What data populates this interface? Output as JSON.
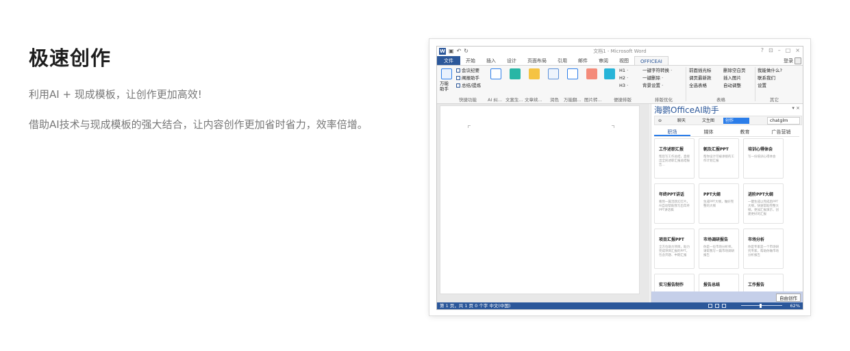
{
  "hero": {
    "title": "极速创作",
    "subtitle1": "利用AI + 现成模板，让创作更加高效!",
    "subtitle2": "借助AI技术与现成模板的强大结合，让内容创作更加省时省力，效率倍增。"
  },
  "word": {
    "doc_title": "文档1 - Microsoft Word",
    "window_controls": [
      "?",
      "⊡",
      "–",
      "□",
      "×"
    ],
    "tabs": [
      "文件",
      "开始",
      "插入",
      "设计",
      "页面布局",
      "引用",
      "邮件",
      "审阅",
      "视图",
      "OFFICEAI"
    ],
    "login": "登录",
    "ribbon": {
      "wanneng": "万能\n助手",
      "meeting": [
        "会议纪要",
        "阐报助手",
        "总结/提炼"
      ],
      "group_labels": [
        "快捷功能",
        "AI 纠...",
        "文案生...",
        "文章续...",
        "润色",
        "万能翻...",
        "图片转...",
        "便捷排版",
        "排版优化",
        "表格",
        "其它"
      ],
      "headings": [
        "H1 ·",
        "H2 ·",
        "H3 ·"
      ],
      "convert": [
        "一键字符转换 ·",
        "一键删除 ·",
        "背景设置 ·"
      ],
      "table_tools": [
        "前面插光标",
        "调页最新款",
        "全选表格"
      ],
      "table_tools2": [
        "删除空白页",
        "插入图片",
        "自动调整"
      ],
      "other": [
        "我能做什么?",
        "联系我们",
        "设置"
      ]
    },
    "status": {
      "left": "第 1 页，共 1 页   0 个字   中文(中国)",
      "zoom": "62%"
    }
  },
  "panel": {
    "title": "海鹦OfficeAI助手",
    "toolbar": [
      "聊天",
      "文生图",
      "创作"
    ],
    "model": "chatglm",
    "tabs": [
      "职场",
      "媒体",
      "教育",
      "广告营销"
    ],
    "cards": [
      {
        "title": "工作述职汇报",
        "desc": "帮您写工作总结，直接出全民述职汇报总结报告..."
      },
      {
        "title": "朝及汇报PPT",
        "desc": "帮你设计可被承接的工作计划汇报"
      },
      {
        "title": "培训心得体会",
        "desc": "写一份培训心得体会"
      },
      {
        "title": "年终PPT讲话",
        "desc": "看到一篇活跃幻灯片，AI自动帮助我写出年终PPT讲话稿"
      },
      {
        "title": "PPT大纲",
        "desc": "生成PPT大纲，做好完整的大纲"
      },
      {
        "title": "进阶PPT大纲",
        "desc": "一键生成以完成后PPT大纲，快速帮助完整大纲，更加汇报演示，创建更好的汇报"
      },
      {
        "title": "项目汇报PPT",
        "desc": "全方位助力项目，助力完成项目汇报的PPT，包含开题、中期汇报"
      },
      {
        "title": "市场调研报告",
        "desc": "你是一位市场分析师，请帮我写一篇市场调研报告"
      },
      {
        "title": "市场分析",
        "desc": "你是专家是一个市场研究专家，帮助你做市场分析报告"
      },
      {
        "title": "实习报告制作",
        "desc": ""
      },
      {
        "title": "报告总结",
        "desc": ""
      },
      {
        "title": "工作报告",
        "desc": ""
      }
    ],
    "free_button": "自由创作"
  }
}
